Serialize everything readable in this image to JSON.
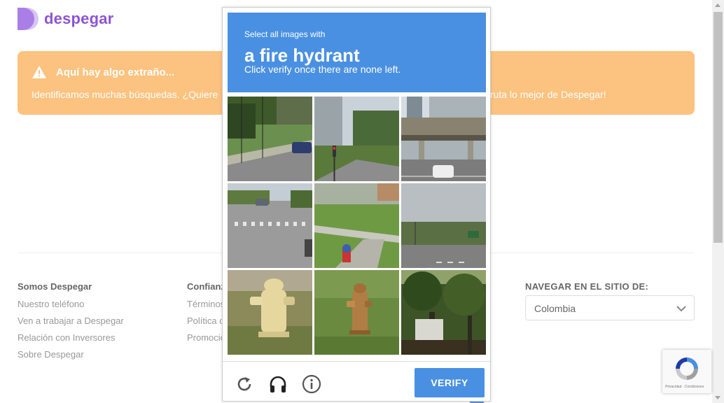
{
  "brand": {
    "name": "despegar",
    "color": "#8c54d6"
  },
  "banner": {
    "title": "Aquí hay algo extraño...",
    "text_left": "Identificamos muchas búsquedas. ¿Quiere",
    "text_right": "fruta lo mejor de Despegar!",
    "icon": "warning-icon",
    "color": "#fcc27f"
  },
  "footer": {
    "col1": {
      "title": "Somos Despegar",
      "links": [
        "Nuestro teléfono",
        "Ven a trabajar a Despegar",
        "Relación con Inversores",
        "Sobre Despegar"
      ]
    },
    "col2": {
      "title": "Confianz",
      "links": [
        "Términos",
        "Política c",
        "Promocio"
      ]
    },
    "nav": {
      "title": "NAVEGAR EN EL SITIO DE:",
      "selected": "Colombia"
    }
  },
  "captcha": {
    "instruction_small": "Select all images with",
    "target": "a fire hydrant",
    "instruction_after": "Click verify once there are none left.",
    "verify_label": "VERIFY",
    "accent": "#4a90e2",
    "tiles": [
      "street-scene",
      "traffic-light-street",
      "overpass-road",
      "crosswalk-road",
      "sidewalk-hydrant",
      "highway-sky",
      "yellow-hydrant",
      "rusty-hydrant",
      "trees-house"
    ],
    "tools": [
      "reload-icon",
      "headphones-icon",
      "info-icon"
    ]
  },
  "recaptcha_badge": {
    "text": "Privacidad - Condiciones"
  }
}
